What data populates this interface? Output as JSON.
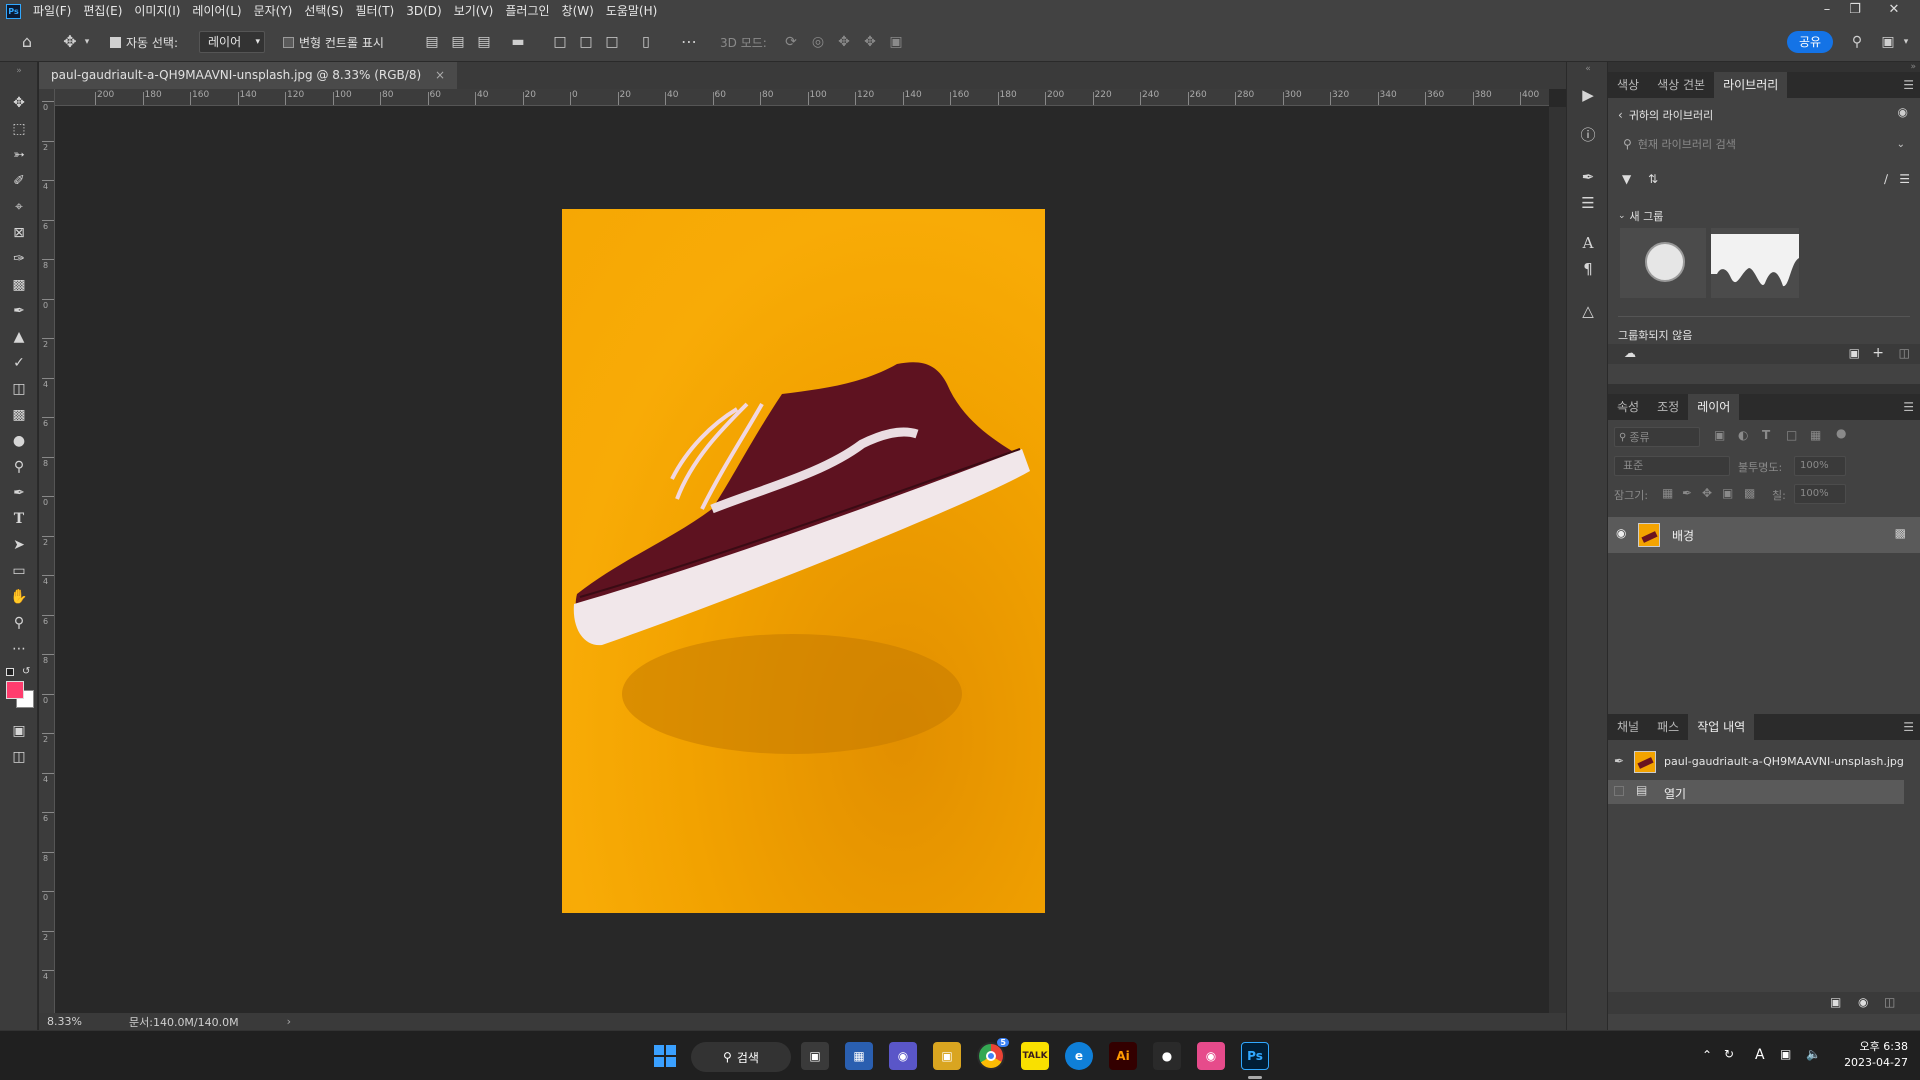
{
  "menubar": {
    "items": [
      "파일(F)",
      "편집(E)",
      "이미지(I)",
      "레이어(L)",
      "문자(Y)",
      "선택(S)",
      "필터(T)",
      "3D(D)",
      "보기(V)",
      "플러그인",
      "창(W)",
      "도움말(H)"
    ]
  },
  "options": {
    "auto_select_label": "자동 선택:",
    "auto_select_value": "레이어",
    "transform_label": "변형 컨트롤 표시",
    "mode3d_label": "3D 모드:",
    "share_label": "공유"
  },
  "document": {
    "tab_title": "paul-gaudriault-a-QH9MAAVNI-unsplash.jpg @ 8.33% (RGB/8)",
    "zoom": "8.33%",
    "doc_size": "문서:140.0M/140.0M"
  },
  "ruler": {
    "h_ticks": [
      "200",
      "180",
      "160",
      "140",
      "120",
      "100",
      "80",
      "60",
      "40",
      "20",
      "0",
      "20",
      "40",
      "60",
      "80",
      "100",
      "120",
      "140",
      "160",
      "180",
      "200",
      "220",
      "240",
      "260",
      "280",
      "300",
      "320",
      "340",
      "360",
      "380",
      "400"
    ],
    "v_ticks": [
      "0",
      "2",
      "4",
      "6",
      "8",
      "0",
      "2",
      "4",
      "6",
      "8",
      "0",
      "2",
      "4",
      "6",
      "8",
      "0",
      "2",
      "4",
      "6",
      "8",
      "0",
      "2",
      "4"
    ]
  },
  "libraries": {
    "tabs": [
      "색상",
      "색상 견본",
      "라이브러리"
    ],
    "back_label": "귀하의 라이브러리",
    "search_placeholder": "현재 라이브러리 검색",
    "group_label": "새 그룹",
    "ungrouped_label": "그룹화되지 않음"
  },
  "layers": {
    "tabs": [
      "속성",
      "조정",
      "레이어"
    ],
    "filter_placeholder": "종류",
    "blend_mode": "표준",
    "opacity_label": "불투명도:",
    "opacity_value": "100%",
    "lock_label": "잠그기:",
    "fill_label": "칠:",
    "fill_value": "100%",
    "layer_name": "배경"
  },
  "history": {
    "tabs": [
      "채널",
      "패스",
      "작업 내역"
    ],
    "snapshot_name": "paul-gaudriault-a-QH9MAAVNI-unsplash.jpg",
    "step_name": "열기"
  },
  "colors": {
    "foreground": "#ff3d6e",
    "background": "#ffffff",
    "canvas_bg": "#282828",
    "image_bg": "#f6a704",
    "accent": "#1473e6"
  },
  "taskbar": {
    "search_label": "검색",
    "time": "오후 6:38",
    "date": "2023-04-27",
    "chrome_badge": "5",
    "ime": "A"
  }
}
